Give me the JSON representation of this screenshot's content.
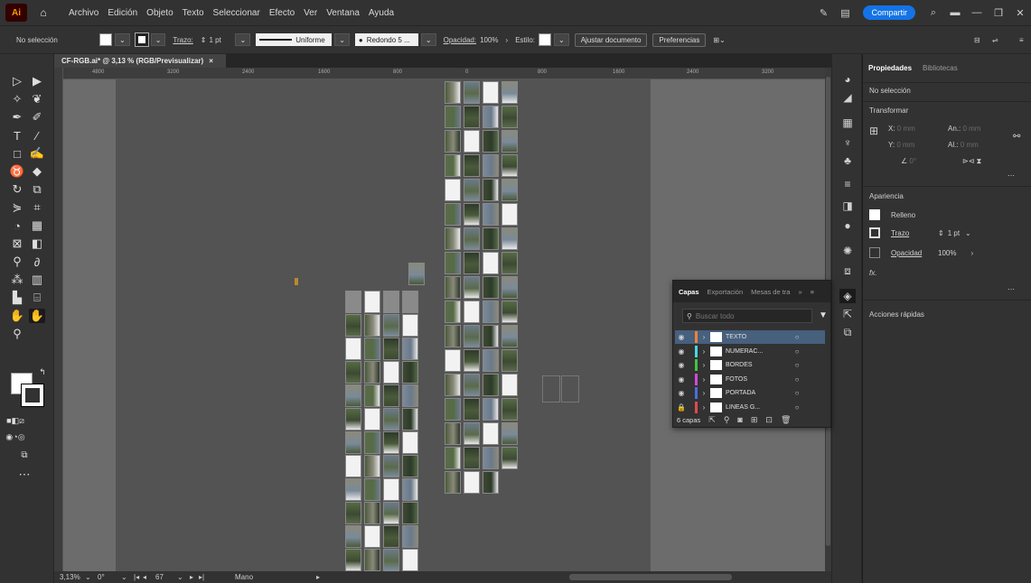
{
  "app": {
    "logo": "Ai",
    "menu": [
      "Archivo",
      "Edición",
      "Objeto",
      "Texto",
      "Seleccionar",
      "Efecto",
      "Ver",
      "Ventana",
      "Ayuda"
    ],
    "share_label": "Compartir"
  },
  "control_bar": {
    "selection_label": "No selección",
    "stroke_label": "Trazo:",
    "stroke_value": "1 pt",
    "profile_label": "Uniforme",
    "brush_label": "Redondo 5 ...",
    "opacity_label": "Opacidad:",
    "opacity_value": "100%",
    "style_label": "Estilo:",
    "adjust_button": "Ajustar documento",
    "prefs_button": "Preferencias"
  },
  "document": {
    "tab_title": "CF-RGB.ai* @ 3,13 % (RGB/Previsualizar)",
    "close_glyph": "×",
    "ruler_marks": [
      "4800",
      "3200",
      "2400",
      "1600",
      "800",
      "0",
      "800",
      "1600",
      "2400",
      "3200"
    ]
  },
  "status_bar": {
    "zoom": "3,13%",
    "angle": "0°",
    "artboard_number": "67",
    "tool_name": "Mano"
  },
  "properties_panel": {
    "tabs": [
      "Propiedades",
      "Bibliotecas"
    ],
    "selection_state": "No selección",
    "transform_title": "Transformar",
    "x_label": "X:",
    "y_label": "Y:",
    "x_value": "0 mm",
    "y_value": "0 mm",
    "w_label": "An.:",
    "h_label": "Al.:",
    "w_value": "0 mm",
    "h_value": "0 mm",
    "angle_value": "0°",
    "appearance_title": "Apariencia",
    "fill_label": "Relleno",
    "stroke_label": "Trazo",
    "stroke_value": "1 pt",
    "opacity_label": "Opacidad",
    "opacity_value": "100%",
    "fx_label": "fx.",
    "quick_actions": "Acciones rápidas"
  },
  "layers_panel": {
    "tabs": [
      "Capas",
      "Exportación",
      "Mesas de tra"
    ],
    "search_placeholder": "Buscar todo",
    "layers": [
      {
        "name": "TEXTO",
        "color": "#f0813a",
        "selected": true
      },
      {
        "name": "NUMERAC...",
        "color": "#4ad6e0",
        "selected": false
      },
      {
        "name": "BORDES",
        "color": "#3ec444",
        "selected": false
      },
      {
        "name": "FOTOS",
        "color": "#d24ad6",
        "selected": false
      },
      {
        "name": "PORTADA",
        "color": "#4a6de0",
        "selected": false
      },
      {
        "name": "LINEAS G...",
        "color": "#e04a4a",
        "selected": false
      }
    ],
    "count_label": "6 capas"
  },
  "colors": {
    "accent": "#1473e6",
    "panel_bg": "#323232",
    "canvas_bg": "#535353",
    "artboard_gray": "#6c6c6c"
  }
}
